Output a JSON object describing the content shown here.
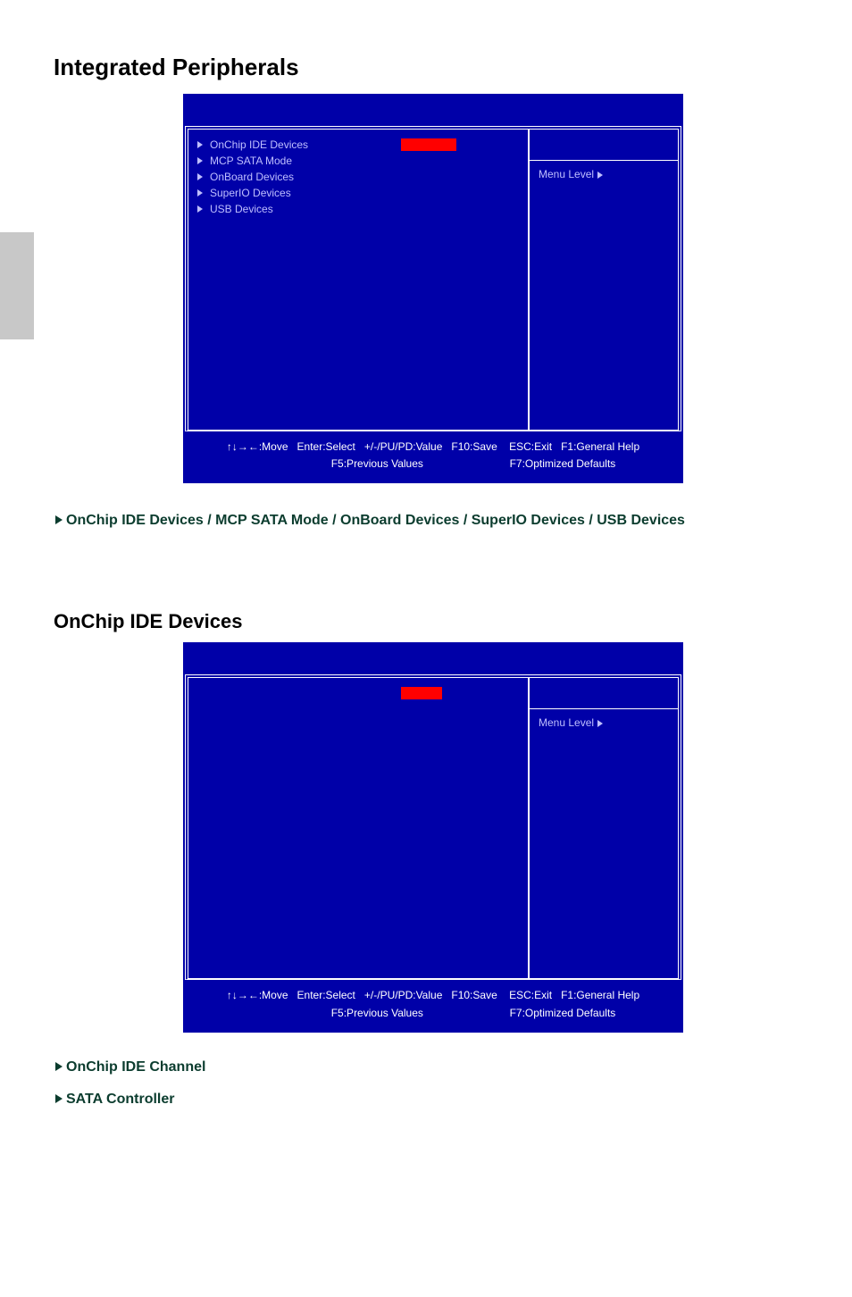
{
  "page": {
    "title": "Integrated Peripherals",
    "section2_title": "OnChip IDE Devices"
  },
  "bios1": {
    "items": [
      "OnChip IDE Devices",
      "MCP SATA Mode",
      "OnBoard Devices",
      "SuperIO Devices",
      "USB Devices"
    ],
    "menu_level": "Menu Level",
    "footer_line": "↑↓→←:Move   Enter:Select   +/-/PU/PD:Value   F10:Save    ESC:Exit   F1:General Help\n                           F5:Previous Values                             F7:Optimized Defaults"
  },
  "bios2": {
    "menu_level": "Menu Level",
    "footer_line": "↑↓→←:Move   Enter:Select   +/-/PU/PD:Value   F10:Save    ESC:Exit   F1:General Help\n                           F5:Previous Values                             F7:Optimized Defaults"
  },
  "desc1": "OnChip IDE Devices / MCP SATA Mode / OnBoard Devices / SuperIO Devices / USB Devices",
  "feature1": "OnChip IDE Channel",
  "feature2": "SATA Controller"
}
